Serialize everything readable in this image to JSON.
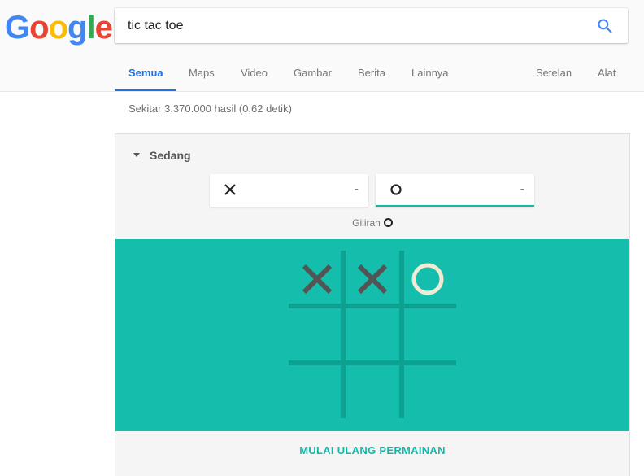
{
  "logo": {
    "text": "Google",
    "letters": [
      "G",
      "o",
      "o",
      "g",
      "l",
      "e"
    ],
    "colors": [
      "#4285F4",
      "#EA4335",
      "#FBBC05",
      "#4285F4",
      "#34A853",
      "#EA4335"
    ]
  },
  "search": {
    "value": "tic tac toe"
  },
  "tabs": [
    {
      "label": "Semua",
      "active": true
    },
    {
      "label": "Maps"
    },
    {
      "label": "Video"
    },
    {
      "label": "Gambar"
    },
    {
      "label": "Berita"
    },
    {
      "label": "Lainnya"
    }
  ],
  "tools": {
    "settings": "Setelan",
    "tools": "Alat"
  },
  "result_stats": "Sekitar 3.370.000 hasil (0,62 detik)",
  "game": {
    "difficulty": "Sedang",
    "player_x": {
      "mark": "X",
      "score": "-"
    },
    "player_o": {
      "mark": "O",
      "score": "-"
    },
    "turn_label": "Giliran",
    "board": [
      "X",
      "X",
      "O",
      "",
      "",
      "",
      "",
      "",
      ""
    ],
    "restart_label": "MULAI ULANG PERMAINAN",
    "colors": {
      "board_bg": "#14bdac",
      "grid": "#0da192",
      "x": "#545454",
      "o": "#f2ebd3",
      "accent": "#14b8a6"
    }
  }
}
